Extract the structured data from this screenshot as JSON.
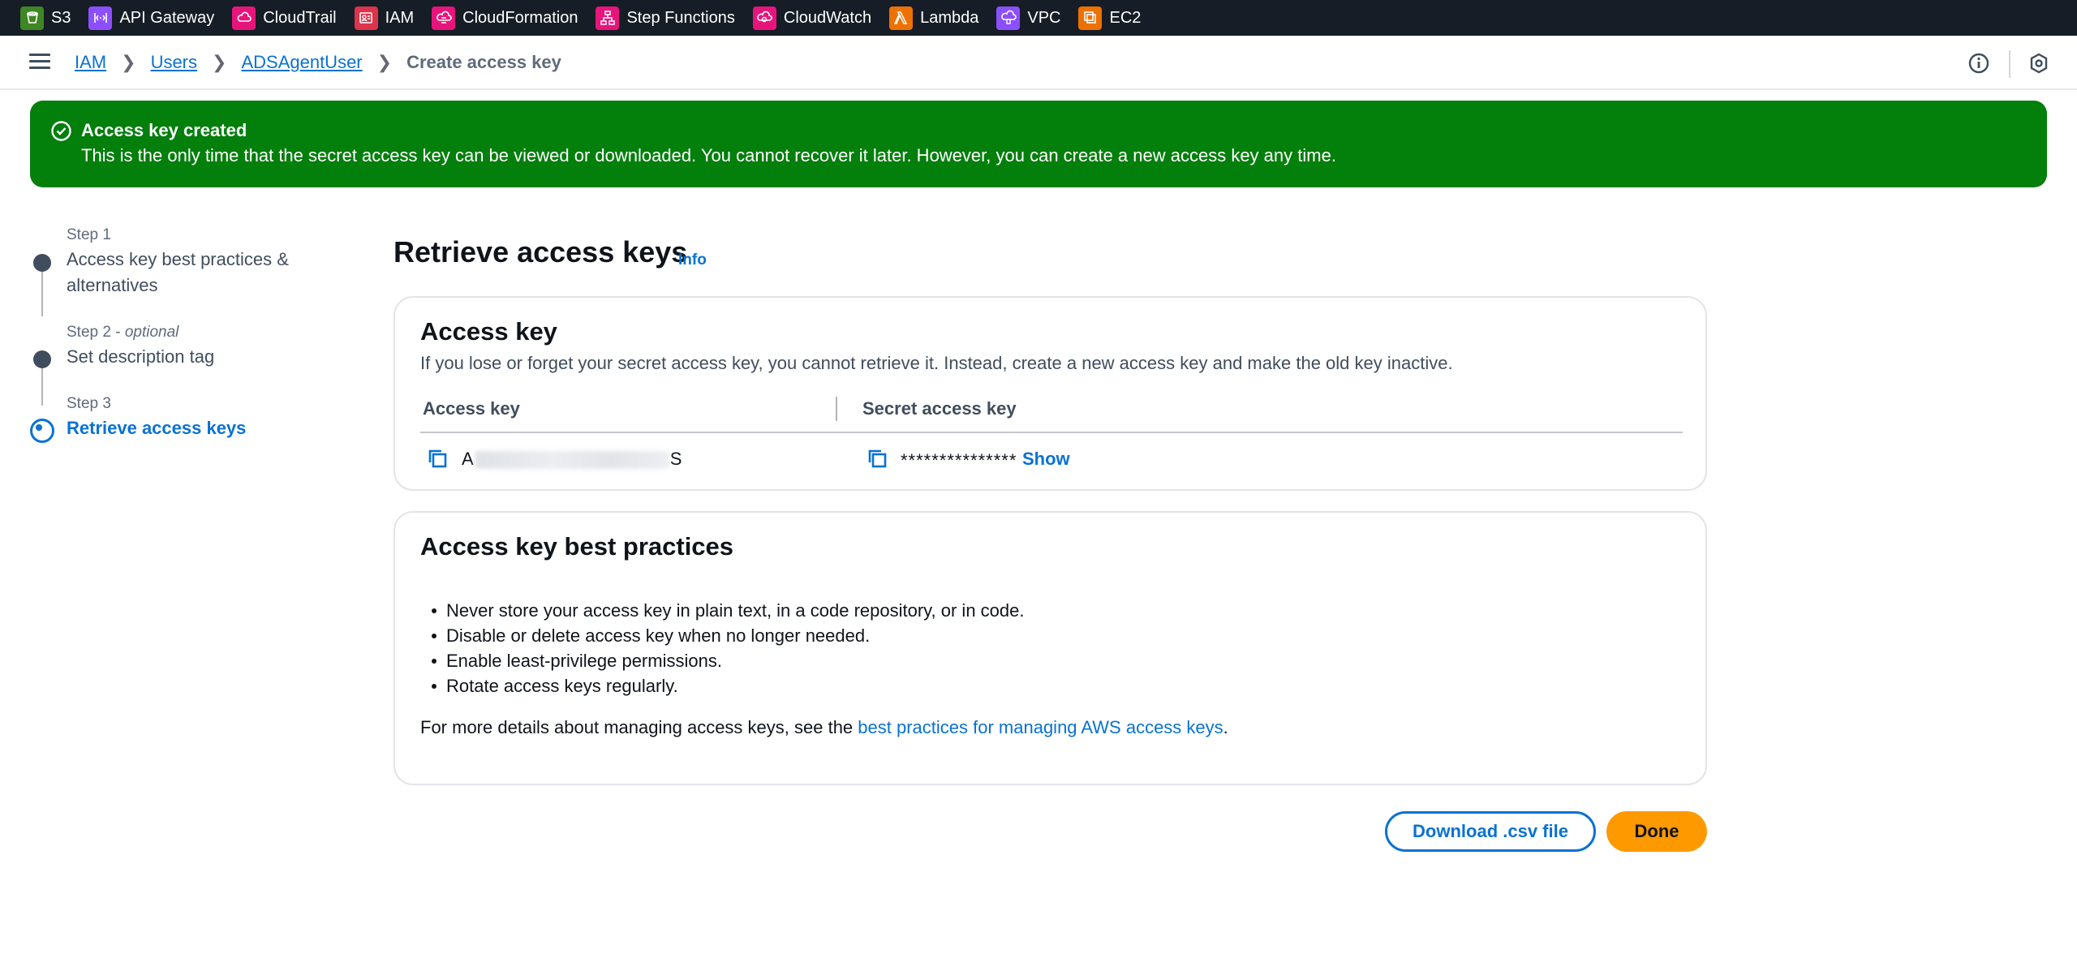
{
  "service_bar": {
    "items": [
      {
        "label": "S3",
        "icon": "s3-icon",
        "color": "#3f8624"
      },
      {
        "label": "API Gateway",
        "icon": "api-gateway-icon",
        "color": "#8c4fff"
      },
      {
        "label": "CloudTrail",
        "icon": "cloudtrail-icon",
        "color": "#e7157b"
      },
      {
        "label": "IAM",
        "icon": "iam-icon",
        "color": "#dd344c"
      },
      {
        "label": "CloudFormation",
        "icon": "cloudformation-icon",
        "color": "#e7157b"
      },
      {
        "label": "Step Functions",
        "icon": "step-functions-icon",
        "color": "#e7157b"
      },
      {
        "label": "CloudWatch",
        "icon": "cloudwatch-icon",
        "color": "#e7157b"
      },
      {
        "label": "Lambda",
        "icon": "lambda-icon",
        "color": "#ed7100"
      },
      {
        "label": "VPC",
        "icon": "vpc-icon",
        "color": "#8c4fff"
      },
      {
        "label": "EC2",
        "icon": "ec2-icon",
        "color": "#ed7100"
      }
    ]
  },
  "breadcrumb": {
    "items": [
      "IAM",
      "Users",
      "ADSAgentUser"
    ],
    "current": "Create access key"
  },
  "flash": {
    "title": "Access key created",
    "message": "This is the only time that the secret access key can be viewed or downloaded. You cannot recover it later. However, you can create a new access key any time."
  },
  "steps": [
    {
      "small": "Step 1",
      "optional": "",
      "label": "Access key best practices &",
      "label2": "alternatives",
      "active": false
    },
    {
      "small": "Step 2 - ",
      "optional": "optional",
      "label": "Set description tag",
      "label2": "",
      "active": false
    },
    {
      "small": "Step 3",
      "optional": "",
      "label": "Retrieve access keys",
      "label2": "",
      "active": true
    }
  ],
  "main": {
    "title": "Retrieve access keys",
    "info": "Info"
  },
  "access_key_card": {
    "title": "Access key",
    "description": "If you lose or forget your secret access key, you cannot retrieve it. Instead, create a new access key and make the old key inactive.",
    "columns": [
      "Access key",
      "Secret access key"
    ],
    "access_key_start": "A",
    "access_key_end": "S",
    "secret_masked": "***************",
    "show": "Show"
  },
  "best_practices": {
    "title": "Access key best practices",
    "items": [
      "Never store your access key in plain text, in a code repository, or in code.",
      "Disable or delete access key when no longer needed.",
      "Enable least-privilege permissions.",
      "Rotate access keys regularly."
    ],
    "more_prefix": "For more details about managing access keys, see the ",
    "more_link": "best practices for managing AWS access keys",
    "more_suffix": "."
  },
  "buttons": {
    "download": "Download .csv file",
    "done": "Done"
  },
  "colors": {
    "success": "#037f0c",
    "link": "#0972d3",
    "primary": "#ff9900",
    "topbar": "#161d26"
  }
}
